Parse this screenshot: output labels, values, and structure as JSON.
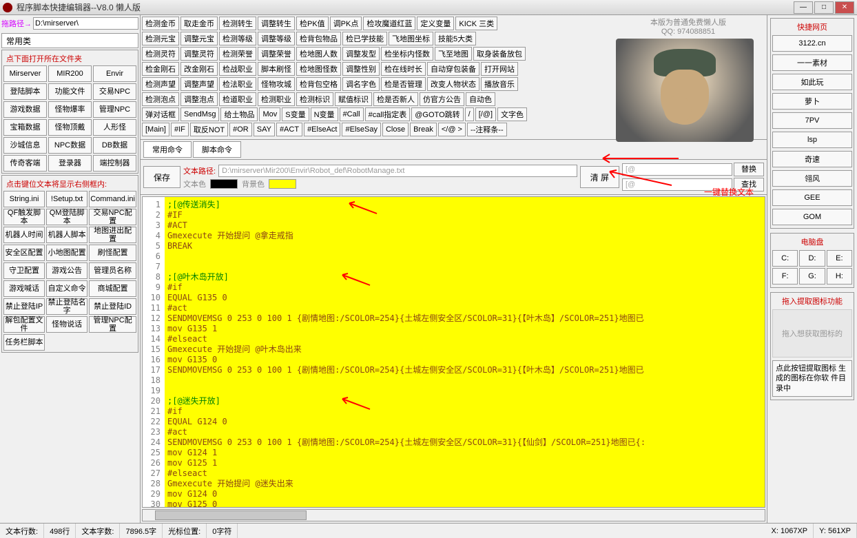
{
  "window": {
    "title": "程序脚本快捷编辑器--V8.0 懒人版"
  },
  "path": {
    "label": "拖路径→",
    "value": "D:\\mirserver\\"
  },
  "left": {
    "tab": "常用类",
    "panel1_title": "点下面打开所在文件夹",
    "panel1": [
      "Mirserver",
      "MIR200",
      "Envir",
      "登陆脚本",
      "功能文件",
      "交易NPC",
      "游戏数据",
      "怪物爆率",
      "管理NPC",
      "宝箱数据",
      "怪物顶戴",
      "人形怪",
      "沙城信息",
      "NPC数据",
      "DB数据",
      "传奇客端",
      "登录器",
      "端控制器"
    ],
    "panel2_title": "点击键位文本将显示右侧框内:",
    "panel2": [
      "String.ini",
      "!Setup.txt",
      "Command.ini",
      "QF触发脚本",
      "QM登陆脚本",
      "交易NPC配置",
      "机器人时间",
      "机器人脚本",
      "地图进出配置",
      "安全区配置",
      "小地图配置",
      "刷怪配置",
      "守卫配置",
      "游戏公告",
      "管理员名称",
      "游戏喊话",
      "自定义命令",
      "商城配置",
      "禁止登陆IP",
      "禁止登陆名字",
      "禁止登陆ID",
      "解包配置文件",
      "怪物说话",
      "管理NPC配置",
      "任务栏脚本",
      "",
      ""
    ]
  },
  "top_rows": [
    [
      "检测金币",
      "取走金币",
      "检测转生",
      "调整转生",
      "检PK值",
      "调PK点",
      "检攻魔道红蓝",
      "定义变量",
      "KICK 三类"
    ],
    [
      "检测元宝",
      "调整元宝",
      "检测等级",
      "调整等级",
      "检背包物品",
      "检已学技能",
      "飞地图坐标",
      "技能5大类"
    ],
    [
      "检测灵符",
      "调整灵符",
      "检测荣誉",
      "调整荣誉",
      "检地图人数",
      "调整发型",
      "检坐标内怪数",
      "飞至地图",
      "取身装备放包"
    ],
    [
      "检金刚石",
      "改金刚石",
      "检战职业",
      "脚本刷怪",
      "检地图怪数",
      "调整性别",
      "检在线时长",
      "自动穿包装备",
      "打开网站"
    ],
    [
      "检测声望",
      "调整声望",
      "检法职业",
      "怪物攻城",
      "检背包空格",
      "调名字色",
      "检是否管理",
      "改变人物状态",
      "播放音乐"
    ],
    [
      "检测泡点",
      "调整泡点",
      "检道职业",
      "检测职业",
      "检测标识",
      "赋值标识",
      "检是否新人",
      "仿官方公告",
      "自动色"
    ],
    [
      "弹对话框",
      "SendMsg",
      "给土物品",
      "Mov",
      "S变量",
      "N变量",
      "#Call",
      "#call指定表",
      "@GOTO跳转",
      "/",
      "[/@]",
      "文字色"
    ],
    [
      "[Main]",
      "#IF",
      "取反NOT",
      "#OR",
      "SAY",
      "#ACT",
      "#ElseAct",
      "#ElseSay",
      "Close",
      "Break",
      "</@ >",
      "--注释条--"
    ]
  ],
  "logo": {
    "line1": "本版为普通免费懒人版",
    "line2": "QQ: 974088851"
  },
  "cmd_tabs": [
    "常用命令",
    "脚本命令"
  ],
  "toolbar": {
    "save": "保存",
    "path_label": "文本路径:",
    "path_value": "D:\\mirserver\\Mir200\\Envir\\Robot_def\\RobotManage.txt",
    "text_color": "文本色",
    "bg_color": "背景色",
    "clear": "清 屏",
    "replace": "替换",
    "find": "查找",
    "search1": "[@",
    "search2": "[@"
  },
  "annotation": "一键替换文本",
  "code_lines": [
    {
      "n": 1,
      "cls": "c-comment",
      "t": ";[@传送消失]"
    },
    {
      "n": 2,
      "cls": "c-dir",
      "t": "#IF"
    },
    {
      "n": 3,
      "cls": "c-dir",
      "t": "#ACT"
    },
    {
      "n": 4,
      "cls": "c-txt",
      "t": "Gmexecute 开始提问 @拿走戒指"
    },
    {
      "n": 5,
      "cls": "c-txt",
      "t": "BREAK"
    },
    {
      "n": 6,
      "cls": "",
      "t": ""
    },
    {
      "n": 7,
      "cls": "",
      "t": ""
    },
    {
      "n": 8,
      "cls": "c-comment",
      "t": ";[@叶木岛开放]"
    },
    {
      "n": 9,
      "cls": "c-dir",
      "t": "#if"
    },
    {
      "n": 10,
      "cls": "c-txt",
      "t": "EQUAL G135 0"
    },
    {
      "n": 11,
      "cls": "c-dir",
      "t": "#act"
    },
    {
      "n": 12,
      "cls": "c-txt",
      "t": "SENDMOVEMSG 0 253 0 100 1 {剧情地图:/SCOLOR=254}{土城左侧安全区/SCOLOR=31}{【叶木岛】/SCOLOR=251}地图已"
    },
    {
      "n": 13,
      "cls": "c-txt",
      "t": "mov G135 1"
    },
    {
      "n": 14,
      "cls": "c-dir",
      "t": "#elseact"
    },
    {
      "n": 15,
      "cls": "c-txt",
      "t": "Gmexecute 开始提问 @叶木岛出来"
    },
    {
      "n": 16,
      "cls": "c-txt",
      "t": "mov G135 0"
    },
    {
      "n": 17,
      "cls": "c-txt",
      "t": "SENDMOVEMSG 0 253 0 100 1 {剧情地图:/SCOLOR=254}{土城左侧安全区/SCOLOR=31}{【叶木岛】/SCOLOR=251}地图已"
    },
    {
      "n": 18,
      "cls": "",
      "t": ""
    },
    {
      "n": 19,
      "cls": "",
      "t": ""
    },
    {
      "n": 20,
      "cls": "c-comment",
      "t": ";[@迷失开放]"
    },
    {
      "n": 21,
      "cls": "c-dir",
      "t": "#if"
    },
    {
      "n": 22,
      "cls": "c-txt",
      "t": "EQUAL G124 0"
    },
    {
      "n": 23,
      "cls": "c-dir",
      "t": "#act"
    },
    {
      "n": 24,
      "cls": "c-txt",
      "t": "SENDMOVEMSG 0 253 0 100 1 {剧情地图:/SCOLOR=254}{土城左侧安全区/SCOLOR=31}{【仙剑】/SCOLOR=251}地图已{:"
    },
    {
      "n": 25,
      "cls": "c-txt",
      "t": "mov G124 1"
    },
    {
      "n": 26,
      "cls": "c-txt",
      "t": "mov G125 1"
    },
    {
      "n": 27,
      "cls": "c-dir",
      "t": "#elseact"
    },
    {
      "n": 28,
      "cls": "c-txt",
      "t": "Gmexecute 开始提问 @迷失出来"
    },
    {
      "n": 29,
      "cls": "c-txt",
      "t": "mov G124 0"
    },
    {
      "n": 30,
      "cls": "c-txt",
      "t": "mov G125 0"
    },
    {
      "n": 31,
      "cls": "",
      "t": ""
    }
  ],
  "right": {
    "panel1_title": "快捷网页",
    "panel1": [
      "3122.cn",
      "一一素材",
      "如此玩",
      "萝卜",
      "7PV",
      "lsp",
      "奇速",
      "翎风",
      "GEE",
      "GOM"
    ],
    "panel2_title": "电脑盘",
    "drives": [
      "C:",
      "D:",
      "E:",
      "F:",
      "G:",
      "H:"
    ],
    "panel3_title": "拖入提取图标功能",
    "drag_text": "拖入想获取图标的",
    "extract_text": "点此按钮提取图标\n生成的图标在你软\n件目录中"
  },
  "status": {
    "rows_label": "文本行数:",
    "rows": "498行",
    "chars_label": "文本字数:",
    "chars": "7896.5字",
    "cursor_label": "光标位置:",
    "cursor": "0字符",
    "x": "X: 1067XP",
    "y": "Y: 561XP"
  }
}
